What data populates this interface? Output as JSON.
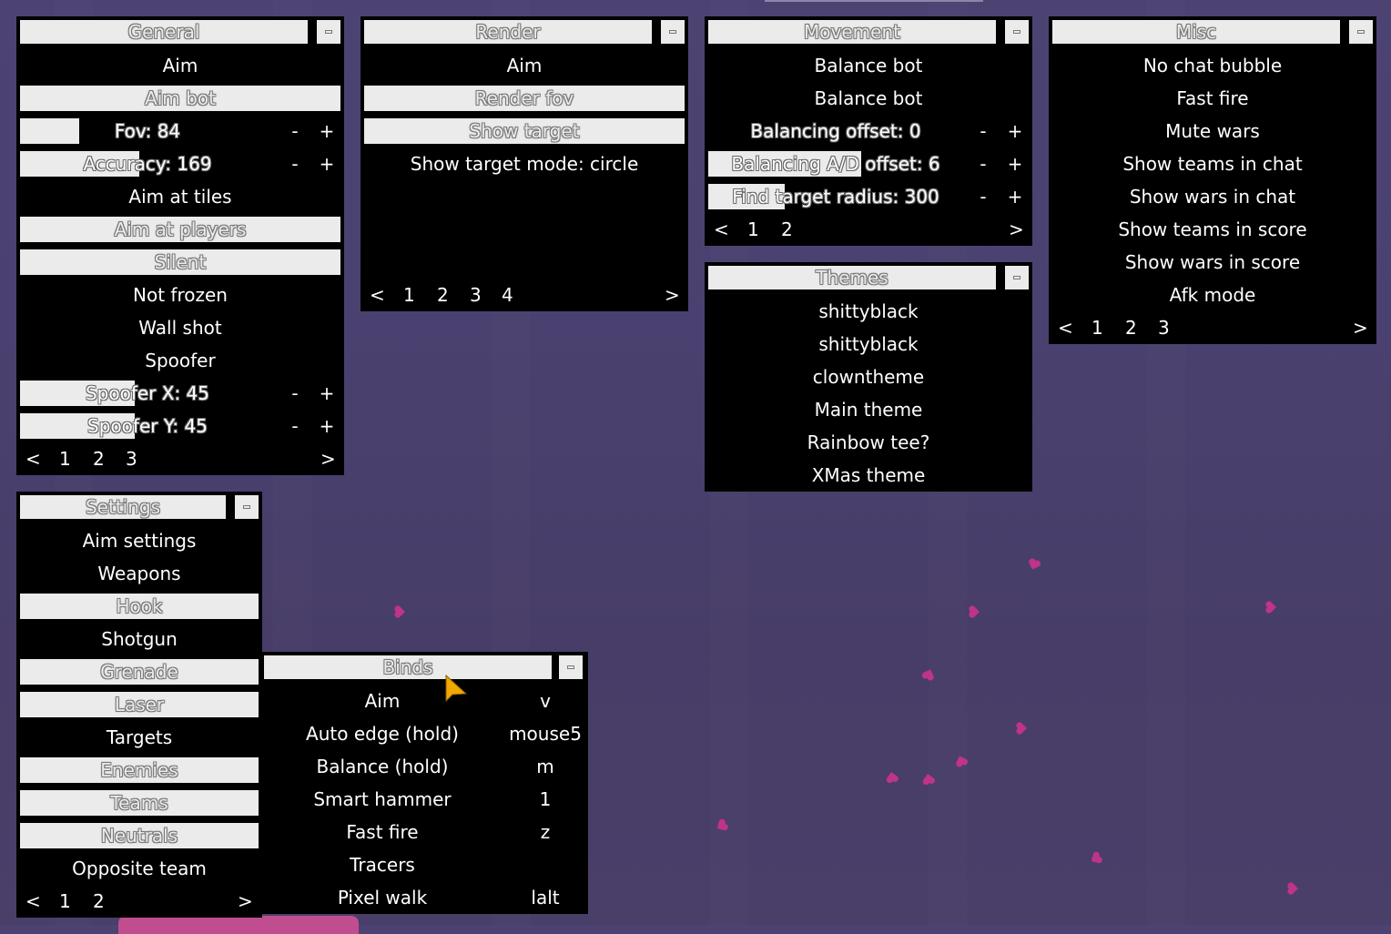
{
  "panels": {
    "general": {
      "title": "General",
      "items": [
        {
          "label": "Aim"
        },
        {
          "label": "Aim bot"
        },
        {
          "label": "Fov: 84",
          "fill": 0.18
        },
        {
          "label": "Accuracy: 169",
          "fill": 0.37
        },
        {
          "label": "Aim at tiles"
        },
        {
          "label": "Aim at players"
        },
        {
          "label": "Silent"
        },
        {
          "label": "Not frozen"
        },
        {
          "label": "Wall shot"
        },
        {
          "label": "Spoofer"
        },
        {
          "label": "Spoofer X: 45",
          "fill": 0.36
        },
        {
          "label": "Spoofer Y: 45",
          "fill": 0.36
        }
      ],
      "pages": [
        "<",
        "1",
        "2",
        "3",
        ">"
      ]
    },
    "render": {
      "title": "Render",
      "items": [
        {
          "label": "Aim"
        },
        {
          "label": "Render fov"
        },
        {
          "label": "Show target"
        },
        {
          "label": "Show target mode: circle"
        }
      ],
      "pages": [
        "<",
        "1",
        "2",
        "3",
        "4",
        ">"
      ]
    },
    "movement": {
      "title": "Movement",
      "items": [
        {
          "label": "Balance bot"
        },
        {
          "label": "Balance bot"
        },
        {
          "label": "Balancing offset: 0",
          "fill": 0.0
        },
        {
          "label": "Balancing A/D offset: 6",
          "fill": 0.48
        },
        {
          "label": "Find target radius: 300",
          "fill": 0.24
        }
      ],
      "pages": [
        "<",
        "1",
        "2",
        ">"
      ]
    },
    "themes": {
      "title": "Themes",
      "items": [
        "shittyblack",
        "shittyblack",
        "clowntheme",
        "Main theme",
        "Rainbow tee?",
        "XMas theme"
      ]
    },
    "misc": {
      "title": "Misc",
      "items": [
        "No chat bubble",
        "Fast fire",
        "Mute wars",
        "Show teams in chat",
        "Show wars in chat",
        "Show teams in score",
        "Show wars in score",
        "Afk mode"
      ],
      "pages": [
        "<",
        "1",
        "2",
        "3",
        ">"
      ]
    },
    "settings": {
      "title": "Settings",
      "items": [
        {
          "label": "Aim settings"
        },
        {
          "label": "Weapons"
        },
        {
          "label": "Hook"
        },
        {
          "label": "Shotgun"
        },
        {
          "label": "Grenade"
        },
        {
          "label": "Laser"
        },
        {
          "label": "Targets"
        },
        {
          "label": "Enemies"
        },
        {
          "label": "Teams"
        },
        {
          "label": "Neutrals"
        },
        {
          "label": "Opposite team"
        }
      ],
      "pages": [
        "<",
        "1",
        "2",
        ">"
      ]
    },
    "binds": {
      "title": "Binds",
      "items": [
        {
          "name": "Aim",
          "key": "v"
        },
        {
          "name": "Auto edge (hold)",
          "key": "mouse5"
        },
        {
          "name": "Balance (hold)",
          "key": "m"
        },
        {
          "name": "Smart hammer",
          "key": "1"
        },
        {
          "name": "Fast fire",
          "key": "z"
        },
        {
          "name": "Tracers",
          "key": ""
        },
        {
          "name": "Pixel walk",
          "key": "lalt"
        }
      ]
    }
  },
  "controls": {
    "minus": "-",
    "plus": "+"
  },
  "colors": {
    "panel_bg": "#000000",
    "selected_bg": "#ebebeb",
    "background": "#4a4170",
    "heart": "#c0338a",
    "cursor": "#f0a800"
  }
}
